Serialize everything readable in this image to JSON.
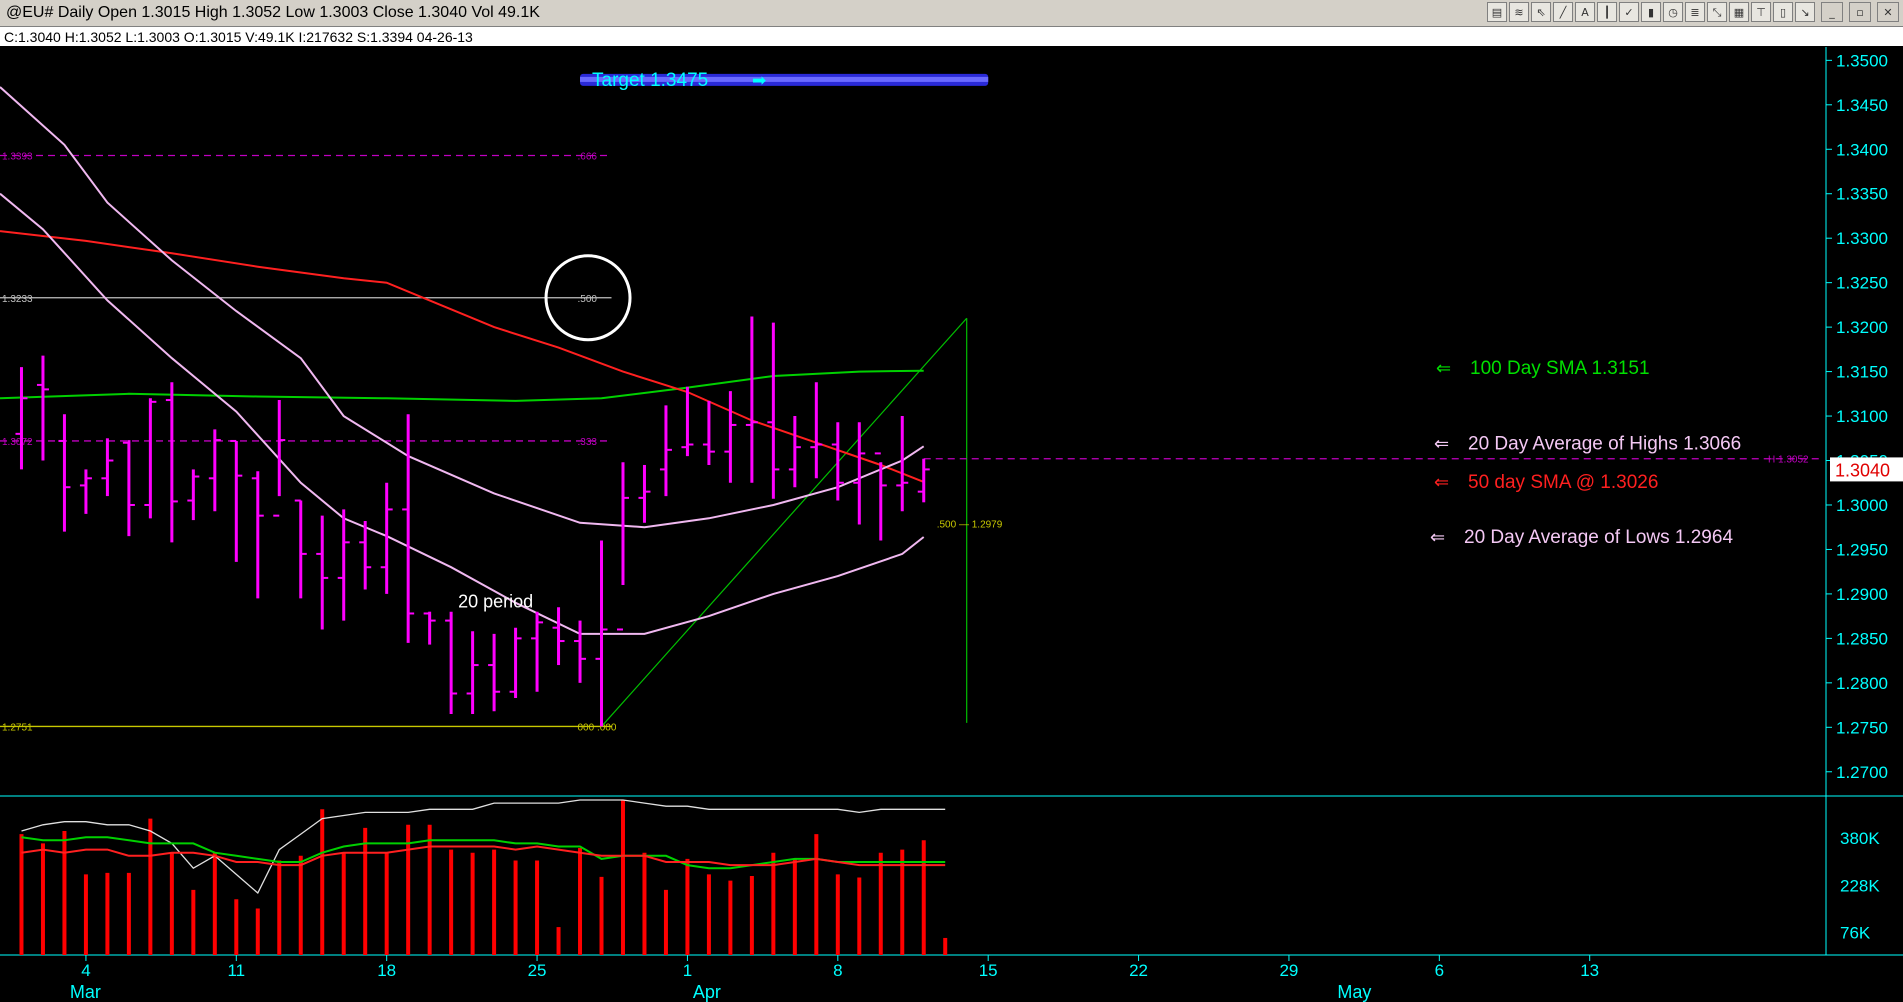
{
  "header": {
    "title": "@EU# Daily Open 1.3015 High 1.3052 Low 1.3003 Close 1.3040 Vol 49.1K",
    "info": "C:1.3040  H:1.3052  L:1.3003  O:1.3015  V:49.1K  I:217632  S:1.3394  04-26-13"
  },
  "toolbar_icons": [
    "data-window-icon",
    "bars-icon",
    "cursor-icon",
    "line-tool-icon",
    "text-tool-icon",
    "indicator-icon",
    "check-icon",
    "scale-icon",
    "clock-icon",
    "fib-icon",
    "zoom-icon",
    "grid-icon",
    "lock-icon",
    "delete-icon",
    "arrow-icon",
    "minimize-icon",
    "restore-icon",
    "close-icon"
  ],
  "colors": {
    "background": "#000000",
    "bars": "#ff00ff",
    "sma50": "#ff2020",
    "sma100": "#00d000",
    "avg20": "#f0b8f0",
    "axis": "#00ffff",
    "fib": "#c000c0",
    "fib_mid": "#c0c0c0",
    "fib_low": "#c8c800",
    "target_band": "#3a3aff",
    "volume_bars": "#ff0000"
  },
  "chart_data": {
    "type": "bar",
    "title": "@EU# Daily",
    "price_axis": {
      "ylim": [
        1.2675,
        1.3515
      ],
      "ticks": [
        1.27,
        1.275,
        1.28,
        1.285,
        1.29,
        1.295,
        1.3,
        1.305,
        1.31,
        1.315,
        1.32,
        1.325,
        1.33,
        1.335,
        1.34,
        1.345,
        1.35
      ]
    },
    "x_axis": {
      "day_ticks": [
        {
          "label": "4",
          "x": 4
        },
        {
          "label": "11",
          "x": 11
        },
        {
          "label": "18",
          "x": 18
        },
        {
          "label": "25",
          "x": 25
        },
        {
          "label": "1",
          "x": 32
        },
        {
          "label": "8",
          "x": 39
        },
        {
          "label": "15",
          "x": 46
        },
        {
          "label": "22",
          "x": 53
        },
        {
          "label": "29",
          "x": 60
        },
        {
          "label": "6",
          "x": 67
        },
        {
          "label": "13",
          "x": 74
        }
      ],
      "month_labels": [
        {
          "label": "Mar",
          "x": 4
        },
        {
          "label": "Apr",
          "x": 33
        },
        {
          "label": "May",
          "x": 63
        }
      ],
      "xlim": [
        0,
        85
      ]
    },
    "ohlc": [
      {
        "x": 1,
        "open": 1.308,
        "high": 1.3155,
        "low": 1.304,
        "close": 1.312
      },
      {
        "x": 2,
        "open": 1.3135,
        "high": 1.3168,
        "low": 1.305,
        "close": 1.313
      },
      {
        "x": 3,
        "open": 1.3072,
        "high": 1.3102,
        "low": 1.297,
        "close": 1.302
      },
      {
        "x": 4,
        "open": 1.3022,
        "high": 1.304,
        "low": 1.299,
        "close": 1.303
      },
      {
        "x": 5,
        "open": 1.303,
        "high": 1.3075,
        "low": 1.301,
        "close": 1.305
      },
      {
        "x": 6,
        "open": 1.307,
        "high": 1.3073,
        "low": 1.2965,
        "close": 1.3
      },
      {
        "x": 7,
        "open": 1.3,
        "high": 1.312,
        "low": 1.2985,
        "close": 1.3116
      },
      {
        "x": 8,
        "open": 1.3118,
        "high": 1.3138,
        "low": 1.2958,
        "close": 1.3004
      },
      {
        "x": 9,
        "open": 1.3005,
        "high": 1.304,
        "low": 1.2983,
        "close": 1.3032
      },
      {
        "x": 10,
        "open": 1.303,
        "high": 1.3085,
        "low": 1.2993,
        "close": 1.3073
      },
      {
        "x": 11,
        "open": 1.3072,
        "high": 1.3072,
        "low": 1.2936,
        "close": 1.3033
      },
      {
        "x": 12,
        "open": 1.303,
        "high": 1.3038,
        "low": 1.2895,
        "close": 1.2988
      },
      {
        "x": 13,
        "open": 1.2988,
        "high": 1.3118,
        "low": 1.301,
        "close": 1.3073
      },
      {
        "x": 14,
        "open": 1.3005,
        "high": 1.3005,
        "low": 1.2895,
        "close": 1.2945
      },
      {
        "x": 15,
        "open": 1.2945,
        "high": 1.2988,
        "low": 1.286,
        "close": 1.2918
      },
      {
        "x": 16,
        "open": 1.2918,
        "high": 1.2995,
        "low": 1.287,
        "close": 1.2958
      },
      {
        "x": 17,
        "open": 1.2958,
        "high": 1.2982,
        "low": 1.2905,
        "close": 1.293
      },
      {
        "x": 18,
        "open": 1.293,
        "high": 1.3025,
        "low": 1.29,
        "close": 1.2995
      },
      {
        "x": 19,
        "open": 1.2995,
        "high": 1.3102,
        "low": 1.2845,
        "close": 1.2878
      },
      {
        "x": 20,
        "open": 1.2878,
        "high": 1.288,
        "low": 1.2843,
        "close": 1.287
      },
      {
        "x": 21,
        "open": 1.287,
        "high": 1.288,
        "low": 1.2765,
        "close": 1.2788
      },
      {
        "x": 22,
        "open": 1.2788,
        "high": 1.2858,
        "low": 1.2765,
        "close": 1.282
      },
      {
        "x": 23,
        "open": 1.282,
        "high": 1.2855,
        "low": 1.2768,
        "close": 1.279
      },
      {
        "x": 24,
        "open": 1.279,
        "high": 1.2862,
        "low": 1.2783,
        "close": 1.285
      },
      {
        "x": 25,
        "open": 1.285,
        "high": 1.288,
        "low": 1.279,
        "close": 1.2868
      },
      {
        "x": 26,
        "open": 1.2862,
        "high": 1.2885,
        "low": 1.282,
        "close": 1.2847
      },
      {
        "x": 27,
        "open": 1.2847,
        "high": 1.287,
        "low": 1.28,
        "close": 1.2827
      },
      {
        "x": 28,
        "open": 1.2827,
        "high": 1.296,
        "low": 1.2751,
        "close": 1.286
      },
      {
        "x": 29,
        "open": 1.286,
        "high": 1.3048,
        "low": 1.291,
        "close": 1.3008
      },
      {
        "x": 30,
        "open": 1.3008,
        "high": 1.3045,
        "low": 1.298,
        "close": 1.3015
      },
      {
        "x": 31,
        "open": 1.304,
        "high": 1.3112,
        "low": 1.301,
        "close": 1.3062
      },
      {
        "x": 32,
        "open": 1.3065,
        "high": 1.3133,
        "low": 1.3055,
        "close": 1.3068
      },
      {
        "x": 33,
        "open": 1.3068,
        "high": 1.3117,
        "low": 1.3045,
        "close": 1.306
      },
      {
        "x": 34,
        "open": 1.306,
        "high": 1.3128,
        "low": 1.3025,
        "close": 1.309
      },
      {
        "x": 35,
        "open": 1.309,
        "high": 1.3212,
        "low": 1.3025,
        "close": 1.3093
      },
      {
        "x": 36,
        "open": 1.3093,
        "high": 1.3205,
        "low": 1.3007,
        "close": 1.304
      },
      {
        "x": 37,
        "open": 1.304,
        "high": 1.31,
        "low": 1.302,
        "close": 1.3065
      },
      {
        "x": 38,
        "open": 1.3065,
        "high": 1.3138,
        "low": 1.303,
        "close": 1.3068
      },
      {
        "x": 39,
        "open": 1.3068,
        "high": 1.3093,
        "low": 1.3005,
        "close": 1.3025
      },
      {
        "x": 40,
        "open": 1.3025,
        "high": 1.3093,
        "low": 1.2978,
        "close": 1.3058
      },
      {
        "x": 41,
        "open": 1.3058,
        "high": 1.3048,
        "low": 1.296,
        "close": 1.3022
      },
      {
        "x": 42,
        "open": 1.3022,
        "high": 1.31,
        "low": 1.2993,
        "close": 1.3025
      },
      {
        "x": 43,
        "open": 1.3015,
        "high": 1.3052,
        "low": 1.3003,
        "close": 1.304
      }
    ],
    "series": [
      {
        "name": "100 Day SMA",
        "color": "#00d000",
        "points": [
          [
            0,
            1.312
          ],
          [
            6,
            1.3125
          ],
          [
            12,
            1.3122
          ],
          [
            18,
            1.312
          ],
          [
            24,
            1.3117
          ],
          [
            28,
            1.312
          ],
          [
            32,
            1.3132
          ],
          [
            36,
            1.3145
          ],
          [
            40,
            1.315
          ],
          [
            43,
            1.3151
          ]
        ]
      },
      {
        "name": "50 day SMA",
        "color": "#ff2020",
        "points": [
          [
            0,
            1.3308
          ],
          [
            4,
            1.3297
          ],
          [
            8,
            1.3283
          ],
          [
            12,
            1.3268
          ],
          [
            16,
            1.3255
          ],
          [
            18,
            1.325
          ],
          [
            20,
            1.323
          ],
          [
            23,
            1.32
          ],
          [
            26,
            1.3177
          ],
          [
            29,
            1.315
          ],
          [
            32,
            1.3127
          ],
          [
            35,
            1.3095
          ],
          [
            38,
            1.307
          ],
          [
            41,
            1.3045
          ],
          [
            43,
            1.3026
          ]
        ]
      },
      {
        "name": "20 Day Average of Highs",
        "color": "#f0b8f0",
        "points": [
          [
            0,
            1.347
          ],
          [
            3,
            1.3405
          ],
          [
            5,
            1.334
          ],
          [
            8,
            1.3275
          ],
          [
            11,
            1.3218
          ],
          [
            14,
            1.3165
          ],
          [
            16,
            1.31
          ],
          [
            19,
            1.3055
          ],
          [
            23,
            1.3013
          ],
          [
            27,
            1.298
          ],
          [
            30,
            1.2975
          ],
          [
            33,
            1.2985
          ],
          [
            36,
            1.3
          ],
          [
            39,
            1.302
          ],
          [
            42,
            1.305
          ],
          [
            43,
            1.3066
          ]
        ]
      },
      {
        "name": "20 Day Average of Lows",
        "color": "#f0b8f0",
        "points": [
          [
            0,
            1.335
          ],
          [
            2,
            1.331
          ],
          [
            5,
            1.323
          ],
          [
            8,
            1.3165
          ],
          [
            11,
            1.3105
          ],
          [
            14,
            1.3025
          ],
          [
            16,
            1.2985
          ],
          [
            18,
            1.2965
          ],
          [
            21,
            1.293
          ],
          [
            24,
            1.289
          ],
          [
            27,
            1.2855
          ],
          [
            30,
            1.2855
          ],
          [
            33,
            1.2875
          ],
          [
            36,
            1.29
          ],
          [
            39,
            1.292
          ],
          [
            42,
            1.2945
          ],
          [
            43,
            1.2964
          ]
        ]
      }
    ],
    "fib_levels": [
      {
        "price": 1.3393,
        "left_label": "1.3393",
        "right_label": ".666",
        "color": "#c000c0",
        "dash": true
      },
      {
        "price": 1.3233,
        "left_label": "1.3233",
        "right_label": ".500",
        "color": "#c0c0c0",
        "dash": false
      },
      {
        "price": 1.3072,
        "left_label": "1.3072",
        "right_label": ".333",
        "color": "#c000c0",
        "dash": true
      },
      {
        "price": 1.2751,
        "left_label": "1.2751",
        "right_label": "000 .000",
        "color": "#c8c800",
        "dash": false
      }
    ],
    "fib_trend": {
      "start": [
        28,
        1.2751
      ],
      "top": [
        45,
        1.321
      ],
      "bottom": [
        45,
        1.2755
      ],
      "label_500": ".500 — 1.2979",
      "label_500_price": 1.2979
    },
    "high_line": {
      "price": 1.3052,
      "label": "H 1.3052",
      "start_x": 43
    },
    "target": {
      "label": "Target   1.3475",
      "arrow": "➡",
      "price": 1.3478,
      "band_start": 27,
      "band_end": 46
    },
    "circle": {
      "x": 27,
      "price": 1.3233
    },
    "period_label": {
      "text": "20 period",
      "x": 23,
      "price": 1.2885
    },
    "annotations": [
      {
        "text": "100 Day SMA 1.3151",
        "color": "#00e000",
        "price": 1.3155,
        "arrow": "⇐"
      },
      {
        "text": "20 Day Average of Highs  1.3066",
        "color": "#f4c8f4",
        "price": 1.307,
        "arrow": "⇐"
      },
      {
        "text": "50 day SMA @ 1.3026",
        "color": "#ff2020",
        "price": 1.3027,
        "arrow": "⇐"
      },
      {
        "text": "20 Day Average of Lows   1.2964",
        "color": "#f4c8f4",
        "price": 1.2965,
        "arrow": "⇐"
      }
    ],
    "last_price_tag": "1.3040",
    "volume": {
      "ylim": [
        0,
        500
      ],
      "ticks": [
        {
          "label": "380K",
          "value": 380
        },
        {
          "label": "228K",
          "value": 228
        },
        {
          "label": "76K",
          "value": 76
        }
      ],
      "bars": [
        390,
        360,
        400,
        260,
        265,
        265,
        440,
        330,
        210,
        330,
        180,
        150,
        305,
        320,
        470,
        330,
        410,
        330,
        420,
        420,
        340,
        330,
        340,
        305,
        305,
        90,
        345,
        252,
        500,
        330,
        210,
        310,
        260,
        240,
        255,
        330,
        310,
        390,
        260,
        250,
        330,
        340,
        370,
        55
      ],
      "avg_line": [
        380,
        370,
        370,
        380,
        380,
        370,
        360,
        360,
        360,
        330,
        320,
        310,
        300,
        300,
        330,
        350,
        360,
        360,
        360,
        370,
        370,
        370,
        370,
        360,
        360,
        350,
        350,
        310,
        320,
        320,
        320,
        290,
        280,
        280,
        290,
        300,
        310,
        310,
        300,
        300,
        300,
        300,
        300,
        300
      ],
      "red_line": [
        330,
        340,
        330,
        340,
        340,
        320,
        320,
        330,
        330,
        320,
        300,
        300,
        290,
        290,
        320,
        330,
        330,
        330,
        340,
        350,
        350,
        350,
        350,
        340,
        350,
        340,
        330,
        320,
        320,
        320,
        300,
        300,
        300,
        290,
        290,
        290,
        300,
        310,
        300,
        290,
        290,
        290,
        290,
        290
      ],
      "white_line": [
        400,
        420,
        430,
        430,
        420,
        420,
        400,
        360,
        280,
        320,
        260,
        200,
        340,
        390,
        440,
        450,
        460,
        460,
        460,
        470,
        470,
        470,
        490,
        490,
        490,
        490,
        500,
        500,
        500,
        490,
        480,
        480,
        470,
        470,
        470,
        470,
        470,
        470,
        470,
        460,
        470,
        470,
        470,
        470
      ]
    }
  }
}
